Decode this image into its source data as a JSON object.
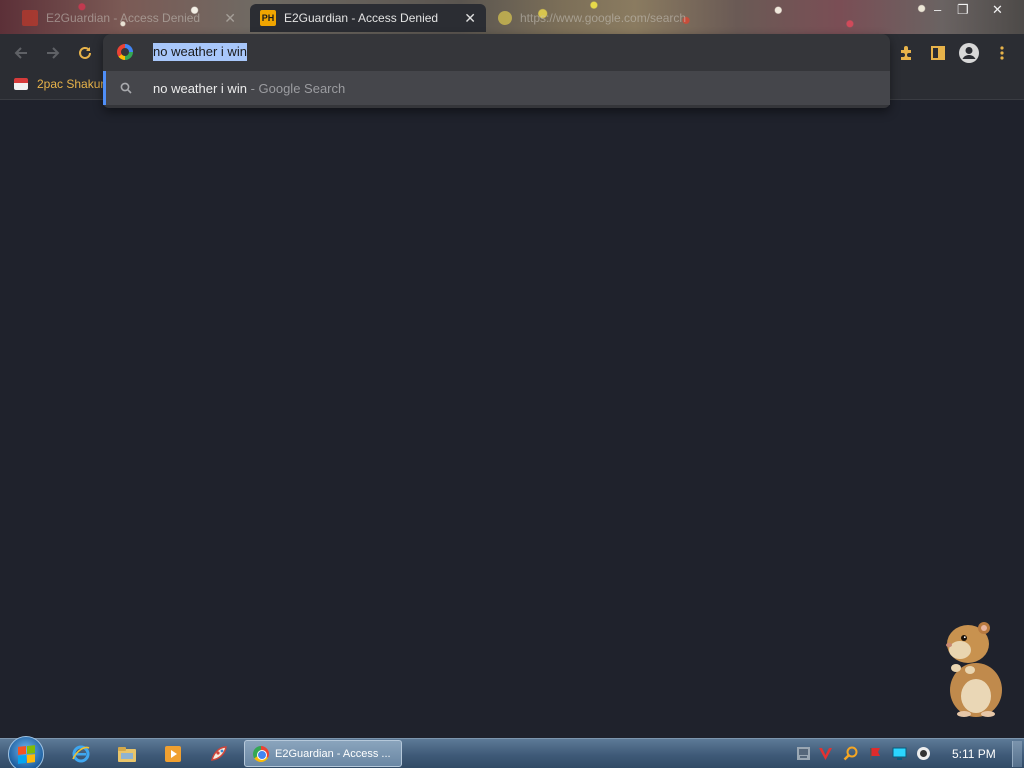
{
  "browser": {
    "tabs": [
      {
        "title": "E2Guardian - Access Denied",
        "state": "inactive",
        "favicon": "red-icon"
      },
      {
        "title": "E2Guardian - Access Denied",
        "state": "active",
        "favicon": "ph-icon",
        "favicon_text": "PH"
      },
      {
        "title": "https://www.google.com/search",
        "state": "inactive",
        "favicon": "google-icon"
      }
    ],
    "window_controls": {
      "minimize": "–",
      "maximize": "❐",
      "close": "✕"
    }
  },
  "toolbar": {
    "back": "back-arrow-icon",
    "forward": "forward-arrow-icon",
    "reload": "reload-icon",
    "extensions": "puzzle-icon",
    "profile": "profile-icon",
    "menu": "kebab-menu-icon"
  },
  "bookmarks": [
    {
      "label": "2pac Shakur"
    }
  ],
  "omnibox": {
    "query": "no weather i win",
    "suggestions": [
      {
        "text": "no weather i win",
        "suffix": " - Google Search",
        "icon": "search-icon"
      }
    ]
  },
  "taskbar": {
    "active_window": "E2Guardian - Access ...",
    "pinned": [
      "internet-explorer-icon",
      "file-explorer-icon",
      "media-player-icon",
      "paint-icon"
    ],
    "tray": [
      "network-icon",
      "antivirus-icon",
      "search-tray-icon",
      "flag-icon",
      "display-icon",
      "volume-icon"
    ],
    "clock": "5:11 PM"
  },
  "colors": {
    "page_bg": "#1f222c",
    "chrome_bg": "#2b2d33",
    "omnibox_bg": "#35363a",
    "selection": "#a8c7fa",
    "suggestion_highlight": "#4f8ef7",
    "bookmark_text": "#e8b34a"
  }
}
